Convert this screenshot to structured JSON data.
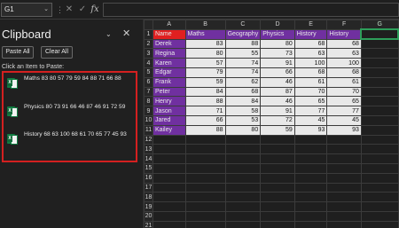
{
  "formula_bar": {
    "name_box": "G1",
    "name_box_arrow": "⌄",
    "cancel_icon": "✕",
    "enter_icon": "✓",
    "fx_label": "fx",
    "separator": "⋮",
    "formula": ""
  },
  "pane": {
    "title": "Clipboard",
    "dropdown_icon": "⌄",
    "close_icon": "✕",
    "paste_all_label": "Paste All",
    "clear_all_label": "Clear All",
    "hint": "Click an Item to Paste:",
    "items": [
      {
        "text": "Maths 83 80 57 79 59 84 88 71 66 88"
      },
      {
        "text": "Physics 80 73 91 66 46 87 46 91 72 59"
      },
      {
        "text": "History 68 63 100 68 61 70 65 77 45 93"
      }
    ]
  },
  "sheet": {
    "columns": [
      "A",
      "B",
      "C",
      "D",
      "E",
      "F",
      "G"
    ],
    "header_row": [
      "Name",
      "Maths",
      "Geography",
      "Physics",
      "History",
      "History",
      ""
    ],
    "rows": [
      [
        "Derek",
        "83",
        "88",
        "80",
        "68",
        "68"
      ],
      [
        "Regina",
        "80",
        "55",
        "73",
        "63",
        "63"
      ],
      [
        "Karen",
        "57",
        "74",
        "91",
        "100",
        "100"
      ],
      [
        "Edgar",
        "79",
        "74",
        "66",
        "68",
        "68"
      ],
      [
        "Frank",
        "59",
        "62",
        "46",
        "61",
        "61"
      ],
      [
        "Peter",
        "84",
        "68",
        "87",
        "70",
        "70"
      ],
      [
        "Henry",
        "88",
        "84",
        "46",
        "65",
        "65"
      ],
      [
        "Jason",
        "71",
        "58",
        "91",
        "77",
        "77"
      ],
      [
        "Jared",
        "66",
        "53",
        "72",
        "45",
        "45"
      ],
      [
        "Kailey",
        "88",
        "80",
        "59",
        "93",
        "93"
      ]
    ],
    "row_numbers": [
      "1",
      "2",
      "3",
      "4",
      "5",
      "6",
      "7",
      "8",
      "9",
      "10",
      "11",
      "12",
      "13",
      "14",
      "15",
      "16",
      "17",
      "18",
      "19",
      "20",
      "21"
    ],
    "colors": {
      "header_purple": "#7030a0",
      "name_header_red": "#e02020",
      "selection_green": "#2e9e5a"
    }
  }
}
